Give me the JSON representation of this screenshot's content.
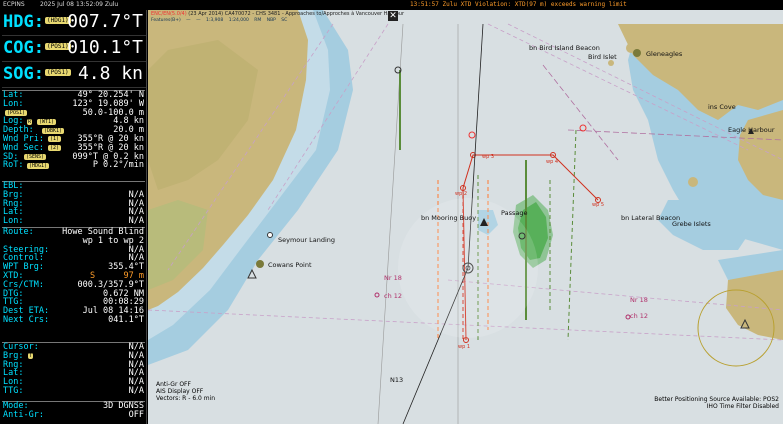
{
  "topbar": {
    "app_title": "ECPINS",
    "date": "2025 Jul 08",
    "time": "13:52:09 Zulu",
    "alarm": "13:51:57 Zulu  XTD Violation: XTD(97 m) exceeds warning limit"
  },
  "nav": {
    "hdg": {
      "label": "HDG:",
      "source": "(HDG1)",
      "value": "007.7°T"
    },
    "cog": {
      "label": "COG:",
      "source": "(POS1)",
      "value": "010.1°T"
    },
    "sog": {
      "label": "SOG:",
      "source": "(POS1)",
      "value": "4.8 kn"
    }
  },
  "position": {
    "lat_label": "Lat:",
    "lat": "49° 20.254' N",
    "lon_label": "Lon:",
    "lon": "123° 19.089' W",
    "pos_src": "(POS1)",
    "range": "50.0-100.0 m",
    "log_label": "Log:",
    "log_tag1": "R",
    "log_tag2": "(WT1)",
    "log": "4.8 kn",
    "depth_label": "Depth:",
    "depth_tag": "(DBK1)",
    "depth": "20.0 m",
    "wndpri_label": "Wnd Pri:",
    "wndpri_tag": "(1)",
    "wndpri": "355°R @ 20 kn",
    "wndsec_label": "Wnd Sec:",
    "wndsec_tag": "(2)",
    "wndsec": "355°R @ 20 kn",
    "sd_label": "SD:",
    "sd_tag": "(SENS)",
    "sd": "099°T @ 0.2 kn",
    "rot_label": "RoT:",
    "rot_tag": "(HDG1)",
    "rot": "P  0.2°/min"
  },
  "ebl": {
    "ebl_label": "EBL:",
    "ebl": "",
    "brg_label": "Brg:",
    "brg": "N/A",
    "rng_label": "Rng:",
    "rng": "N/A",
    "lat_label": "Lat:",
    "lat": "N/A",
    "lon_label": "Lon:",
    "lon": "N/A"
  },
  "route": {
    "route_label": "Route:",
    "route": "Howe Sound Blind",
    "legs": "wp 1 to wp 2",
    "steering_label": "Steering:",
    "steering": "N/A",
    "control_label": "Control:",
    "control": "N/A",
    "wptbrg_label": "WPT Brg:",
    "wptbrg": "355.4°T",
    "xtd_label": "XTD:",
    "xtd_side": "S",
    "xtd": "97 m",
    "crs_label": "Crs/CTM:",
    "crs": "000.3/357.9°T",
    "dtg_label": "DTG:",
    "dtg": "0.672 NM",
    "ttg_label": "TTG:",
    "ttg": "00:08:29",
    "eta_label": "Dest ETA:",
    "eta": "Jul 08 14:16",
    "next_label": "Next Crs:",
    "next": "041.1°T"
  },
  "cursor": {
    "cursor_label": "Cursor:",
    "cursor": "N/A",
    "brg_label": "Brg:",
    "brg_tag": "T",
    "brg": "N/A",
    "rng_label": "Rng:",
    "rng": "N/A",
    "lat_label": "Lat:",
    "lat": "N/A",
    "lon_label": "Lon:",
    "lon": "N/A",
    "ttg_label": "TTG:",
    "ttg": "N/A"
  },
  "mode": {
    "mode_label": "Mode:",
    "mode": "3D DGNSS",
    "antigr_label": "Anti-Gr:",
    "antigr": "OFF"
  },
  "chart": {
    "info_prefix": "ENC/EN(5.0/4)",
    "info": "(23 Apr 2014) CA470072 - CHS 3481 - Approaches to/Approches à Vancouver Harbour",
    "layer_line": "Features(B+) — —   1:3,908   1:24,000   RM   NBP   SC",
    "labels": {
      "bird_island": "bn Bird Island Beacon",
      "bird_islet": "Bird Islet",
      "gleneagles": "Gleneagles",
      "cove": "ins Cove",
      "eagle_harbour": "Eagle Harbour",
      "mooring_buoy": "bn Mooring Buoy",
      "passage": "Passage",
      "lateral_beacon": "bn Lateral Beacon",
      "grebe_islets": "Grebe Islets",
      "seymour_landing": "Seymour Landing",
      "cowans_point": "Cowans Point",
      "nr18_a": "Nr 18",
      "ch12_a": "ch 12",
      "nr18_b": "Nr 18",
      "ch12_b": "ch 12",
      "n13": "N13",
      "wp1": "wp 1",
      "wp2": "wp 2",
      "wp3": "wp 3",
      "wp4": "wp 4",
      "wp5": "wp 5"
    },
    "status_left": [
      "Anti-Gr OFF",
      "AIS Display OFF",
      "Vectors: R - 6.0 min"
    ],
    "status_right": [
      "Better Positioning Source Available: POS2",
      "IHO Time Filter Disabled"
    ],
    "colors": {
      "land": "#c9b77c",
      "deep": "#d8dfe2",
      "shallow": "#a5cde0",
      "route": "#d0301e",
      "alarm": "#ff9d2a",
      "label": "#00e0ff"
    }
  }
}
